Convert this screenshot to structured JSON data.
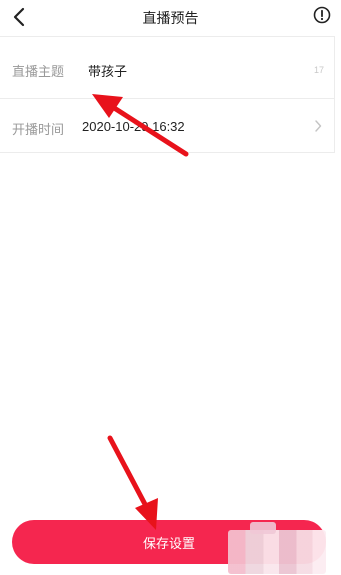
{
  "header": {
    "title": "直播预告",
    "back_icon": "back-arrow-icon",
    "info_icon": "info-circle-icon"
  },
  "form": {
    "topic": {
      "label": "直播主题",
      "value": "带孩子",
      "counter": "17"
    },
    "start_time": {
      "label": "开播时间",
      "value": "2020-10-29 16:32",
      "chevron_icon": "chevron-right-icon"
    }
  },
  "footer": {
    "save_label": "保存设置"
  },
  "colors": {
    "accent": "#f5264f",
    "annotation_arrow": "#e8121b",
    "label": "#999999",
    "text": "#222222"
  }
}
